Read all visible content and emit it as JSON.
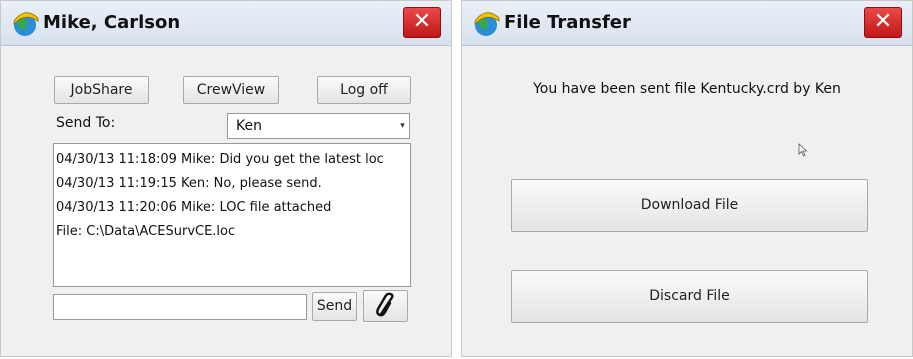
{
  "chat_window": {
    "title": "Mike, Carlson",
    "close_label": "✕",
    "buttons": {
      "jobshare": "JobShare",
      "crewview": "CrewView",
      "logoff": "Log off"
    },
    "send_to_label": "Send To:",
    "send_to_value": "Ken",
    "messages": [
      "04/30/13 11:18:09 Mike: Did you get the latest loc",
      "04/30/13 11:19:15 Ken: No, please send.",
      "04/30/13 11:20:06 Mike: LOC file attached",
      "File: C:\\Data\\ACESurvCE.loc"
    ],
    "message_input_value": "",
    "send_label": "Send",
    "attach_icon": "paperclip-icon"
  },
  "transfer_window": {
    "title": "File Transfer",
    "close_label": "✕",
    "message": "You have been sent file Kentucky.crd by Ken",
    "download_label": "Download File",
    "discard_label": "Discard File"
  },
  "colors": {
    "close_red": "#d42020",
    "titlebar": "#dfe7f1"
  }
}
